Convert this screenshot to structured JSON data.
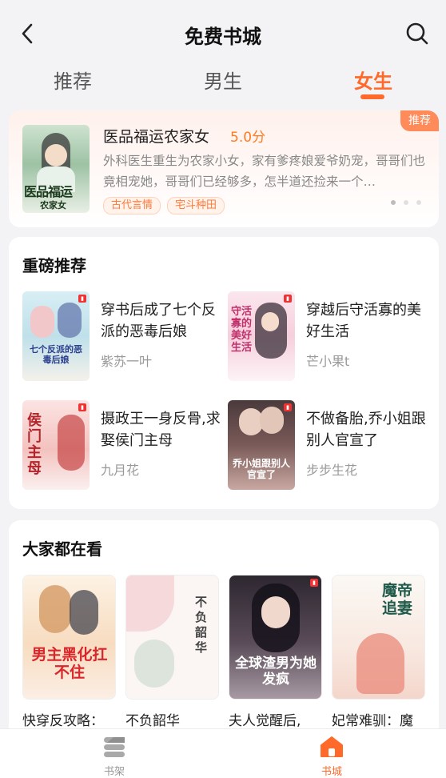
{
  "header": {
    "title": "免费书城",
    "tabs": [
      {
        "label": "推荐",
        "active": false
      },
      {
        "label": "男生",
        "active": false
      },
      {
        "label": "女生",
        "active": true
      }
    ],
    "accent_color": "#ff6a2a"
  },
  "featured": {
    "badge": "推荐",
    "title": "医品福运农家女",
    "score": "5.0分",
    "description": "外科医生重生为农家小女，家有爹疼娘爱爷奶宠，哥哥们也竟相宠她，哥哥们已经够多，怎半道还捡来一个…",
    "tags": [
      "古代言情",
      "宅斗种田"
    ],
    "cover_text": "医品福运",
    "cover_subtext": "农家女",
    "carousel_dots": 3,
    "carousel_active": 0
  },
  "heavy_recommend": {
    "title": "重磅推荐",
    "books": [
      {
        "title": "穿书后成了七个反派的恶毒后娘",
        "author": "紫苏一叶",
        "cover_text": "七个反派的恶毒后娘"
      },
      {
        "title": "穿越后守活寡的美好生活",
        "author": "芒小果t",
        "cover_text": "守活寡的美好生活"
      },
      {
        "title": "摄政王一身反骨,求娶侯门主母",
        "author": "九月花",
        "cover_text": "侯门主母"
      },
      {
        "title": "不做备胎,乔小姐跟别人官宣了",
        "author": "步步生花",
        "cover_text": "乔小姐跟别人官宣了"
      }
    ]
  },
  "everyone_watching": {
    "title": "大家都在看",
    "books": [
      {
        "title": "快穿反攻略：",
        "cover_text": "男主黑化扛不住"
      },
      {
        "title": "不负韶华",
        "cover_text": "不负韶华"
      },
      {
        "title": "夫人觉醒后,",
        "cover_text": "全球渣男为她发疯"
      },
      {
        "title": "妃常难驯：魔",
        "cover_text": "魔帝追妻"
      }
    ]
  },
  "bottom_nav": [
    {
      "label": "书架",
      "icon": "bookshelf-icon",
      "active": false
    },
    {
      "label": "书城",
      "icon": "home-icon",
      "active": true
    }
  ]
}
